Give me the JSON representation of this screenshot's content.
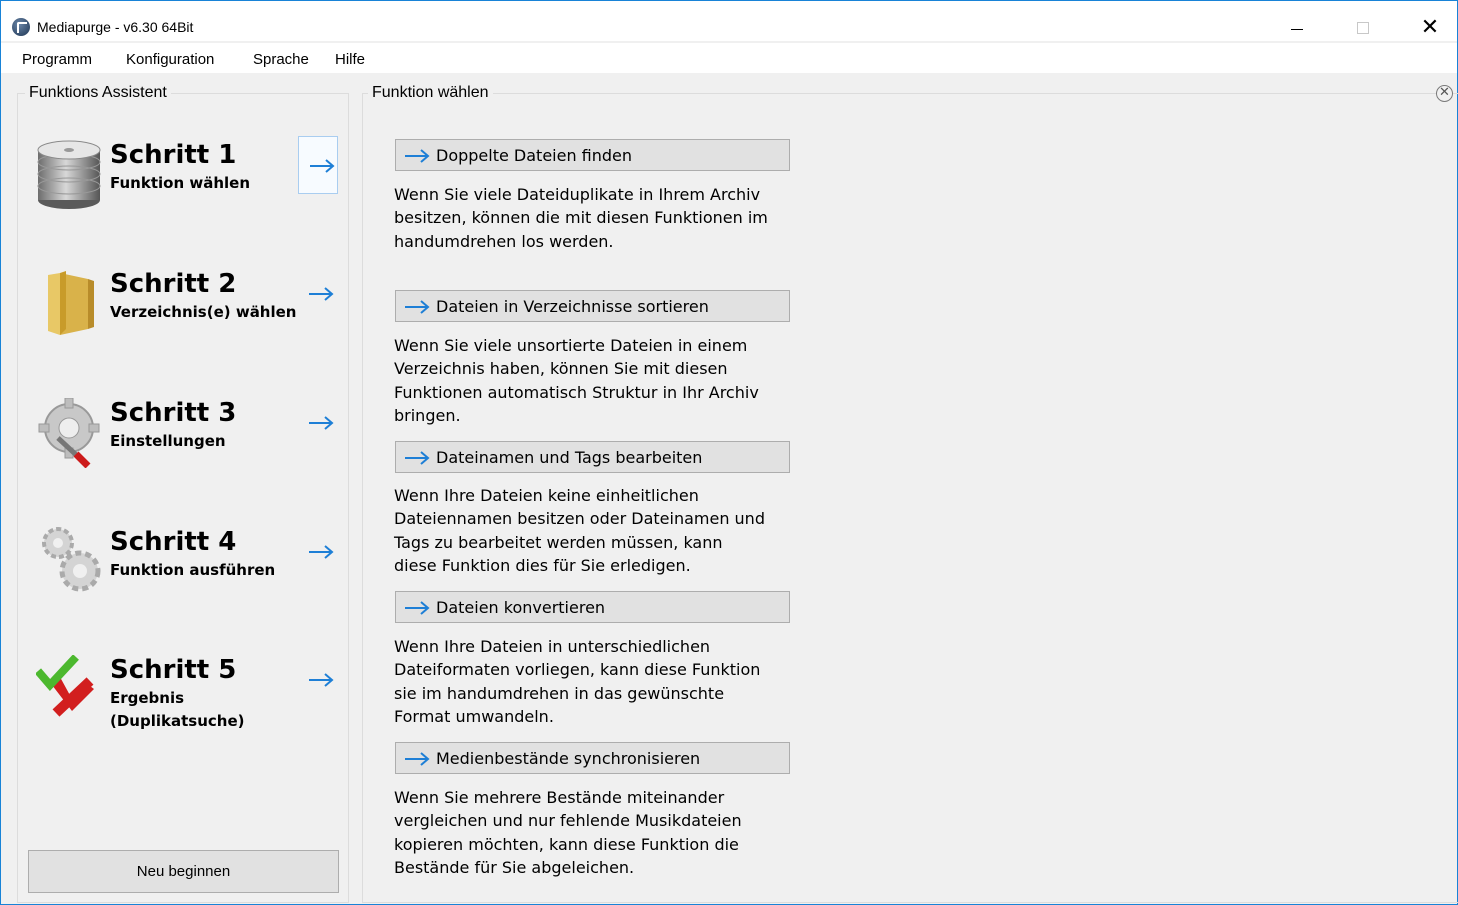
{
  "window": {
    "title": "Mediapurge - v6.30 64Bit",
    "close_glyph": "✕"
  },
  "menu": [
    "Programm",
    "Konfiguration",
    "Sprache",
    "Hilfe"
  ],
  "assistant": {
    "caption": "Funktions Assistent",
    "steps": [
      {
        "title": "Schritt 1",
        "subtitle": "Funktion wählen",
        "icon": "database-icon",
        "active": true
      },
      {
        "title": "Schritt 2",
        "subtitle": "Verzeichnis(e) wählen",
        "icon": "folder-icon",
        "active": false
      },
      {
        "title": "Schritt 3",
        "subtitle": "Einstellungen",
        "icon": "settings-wrench-icon",
        "active": false
      },
      {
        "title": "Schritt 4",
        "subtitle": "Funktion ausführen",
        "icon": "gears-icon",
        "active": false
      },
      {
        "title": "Schritt 5",
        "subtitle": "Ergebnis\n(Duplikatsuche)",
        "icon": "check-cross-icon",
        "active": false
      }
    ],
    "restart_label": "Neu beginnen"
  },
  "functions": {
    "caption": "Funktion wählen",
    "close_glyph": "✕",
    "items": [
      {
        "label": "Doppelte Dateien finden",
        "description": "Wenn Sie viele Dateiduplikate in Ihrem Archiv\nbesitzen, können die mit diesen Funktionen im\nhandumdrehen los werden."
      },
      {
        "label": "Dateien in Verzeichnisse sortieren",
        "description": "Wenn Sie viele unsortierte Dateien in einem\nVerzeichnis  haben, können Sie mit diesen\nFunktionen automatisch Struktur in Ihr Archiv\nbringen."
      },
      {
        "label": "Dateinamen und Tags bearbeiten",
        "description": "Wenn Ihre Dateien keine einheitlichen\nDateiennamen besitzen oder Dateinamen und\nTags zu bearbeitet werden müssen, kann\ndiese Funktion dies für Sie erledigen."
      },
      {
        "label": "Dateien konvertieren",
        "description": "Wenn Ihre Dateien in unterschiedlichen\nDateiformaten vorliegen, kann diese Funktion\nsie im handumdrehen in das gewünschte\nFormat umwandeln."
      },
      {
        "label": "Medienbestände synchronisieren",
        "description": "Wenn Sie mehrere Bestände miteinander\nvergleichen und nur fehlende Musikdateien\nkopieren möchten, kann diese Funktion die\nBestände für Sie abgeleichen."
      }
    ]
  },
  "colors": {
    "accent_arrow": "#1e7fd6",
    "window_border": "#1883d7",
    "button_face": "#e1e1e1"
  }
}
